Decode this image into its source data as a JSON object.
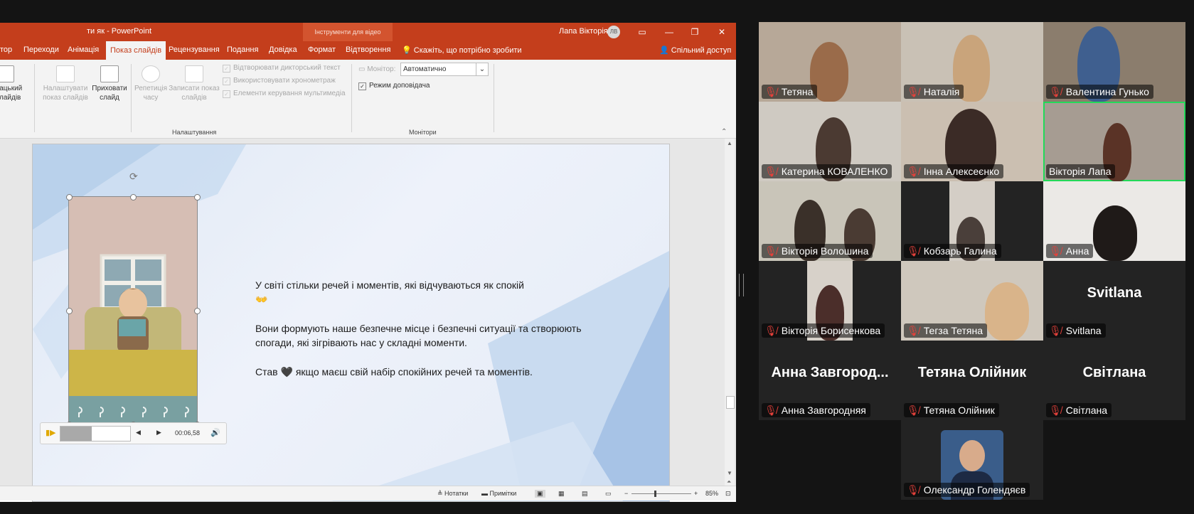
{
  "powerpoint": {
    "doc_title": "ти як  -  PowerPoint",
    "contextual_tab": "Інструменти для відео",
    "user_name": "Лапа Вікторія",
    "user_initials": "ЛВ",
    "tabs": [
      "тор",
      "Переходи",
      "Анімація",
      "Показ слайдів",
      "Рецензування",
      "Подання",
      "Довідка",
      "Формат",
      "Відтворення"
    ],
    "active_tab": "Показ слайдів",
    "tell_me": "Скажіть, що потрібно зробити",
    "share": "Спільний доступ",
    "ribbon": {
      "custom_show": "вацький слайдів",
      "setup_show": "Налаштувати показ слайдів",
      "hide_slide": "Приховати слайд",
      "rehearse": "Репетиція часу",
      "record": "Записати показ слайдів",
      "chk_narration": "Відтворювати дикторський текст",
      "chk_timings": "Використовувати хронометраж",
      "chk_media": "Елементи керування мультимедіа",
      "group_setup": "Налаштування",
      "monitor_label": "Монітор:",
      "monitor_value": "Автоматично",
      "presenter_view": "Режим доповідача",
      "group_monitors": "Монітори"
    },
    "slide": {
      "line1": "У світі стільки речей і моментів, які відчуваються як спокій",
      "line1_emoji": "👐",
      "line2": "Вони формують наше безпечне місце і безпечні ситуації та створюють спогади, які зігрівають нас у складні моменти.",
      "line3_a": "Став",
      "line3_emoji": "🖤",
      "line3_b": "якщо маєш свій набір спокійних речей та моментів."
    },
    "player": {
      "time": "00:06,58"
    },
    "status": {
      "notes": "Нотатки",
      "comments": "Примітки",
      "zoom": "85%"
    }
  },
  "zoom": {
    "participants": [
      {
        "name": "Тетяна"
      },
      {
        "name": "Наталія"
      },
      {
        "name": "Валентина Гунько"
      },
      {
        "name": "Катерина КОВАЛЕНКО"
      },
      {
        "name": "Інна Алексеєнко"
      },
      {
        "name": "Вікторія Лапа"
      },
      {
        "name": "Вікторія Волошина"
      },
      {
        "name": "Кобзарь Галина"
      },
      {
        "name": "Анна"
      },
      {
        "name": "Вікторія Борисенкова"
      },
      {
        "name": "Тегза Тетяна"
      },
      {
        "name": "Svitlana",
        "big": "Svitlana"
      },
      {
        "name": "Анна Завгородняя",
        "big": "Анна  Завгород..."
      },
      {
        "name": "Тетяна Олійник",
        "big": "Тетяна  Олійник"
      },
      {
        "name": "Світлана",
        "big": "Світлана"
      },
      {
        "name": "Олександр Голендяєв"
      }
    ]
  }
}
